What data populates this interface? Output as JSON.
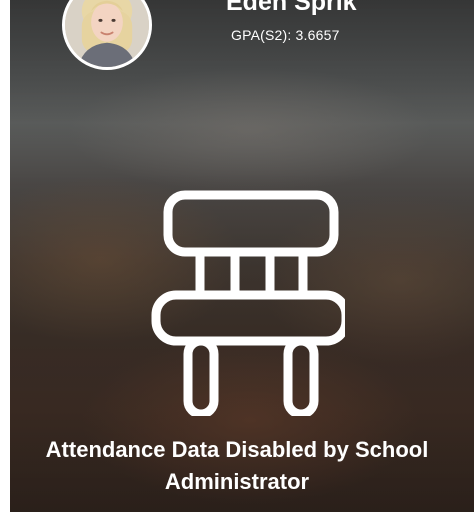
{
  "student": {
    "name": "Eden Sprik",
    "gpa_text": "GPA(S2): 3.6657"
  },
  "attendance": {
    "icon": "chair-icon",
    "message_line1": "Attendance Data Disabled by School",
    "message_line2": "Administrator"
  },
  "colors": {
    "text": "#ffffff",
    "icon_stroke": "#ffffff",
    "background_top": "#3a3b3b",
    "background_bottom": "#2f231d"
  }
}
